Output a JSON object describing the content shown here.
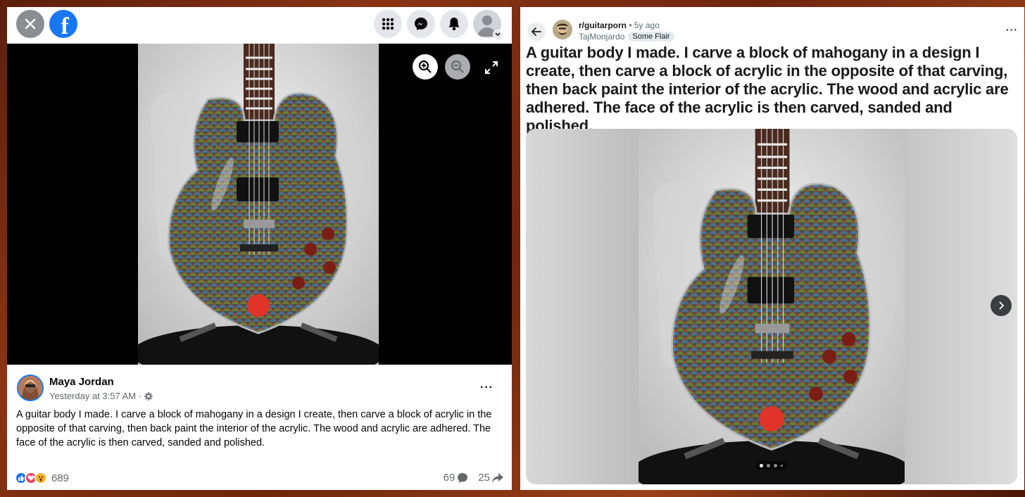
{
  "facebook": {
    "author": "Maya Jordan",
    "timestamp": "Yesterday at 3:57 AM",
    "separator": "·",
    "more": "···",
    "post_text": "A guitar body I made. I carve a block of mahogany in a design I create, then carve a block of acrylic in the opposite of that carving, then back paint the interior of the acrylic. The wood and acrylic are adhered. The face of the acrylic is then carved, sanded and polished.",
    "reactions_count": "689",
    "comments_count": "69",
    "shares_count": "25",
    "brand_color": "#1877f2",
    "icons": [
      "close-icon",
      "facebook-logo",
      "menu-grid-icon",
      "messenger-icon",
      "bell-icon",
      "profile-icon",
      "zoom-in-icon",
      "zoom-out-icon",
      "expand-icon",
      "globe-settings-icon",
      "like-reaction-icon",
      "love-reaction-icon",
      "wow-reaction-icon",
      "comment-icon",
      "share-icon"
    ]
  },
  "reddit": {
    "subreddit": "r/guitarporn",
    "time": " • 5y ago",
    "username": "TajMonjardo",
    "flair": "Some Flair",
    "more": "···",
    "title": "A guitar body I made. I carve a block of mahogany in a design I create, then carve a block of acrylic in the opposite of that carving, then back paint the interior of the acrylic. The wood and acrylic are adhered. The face of the acrylic is then carved, sanded and polished.",
    "gallery_index": 1,
    "gallery_dots": 4,
    "icons": [
      "back-arrow-icon",
      "next-chevron-icon"
    ]
  }
}
